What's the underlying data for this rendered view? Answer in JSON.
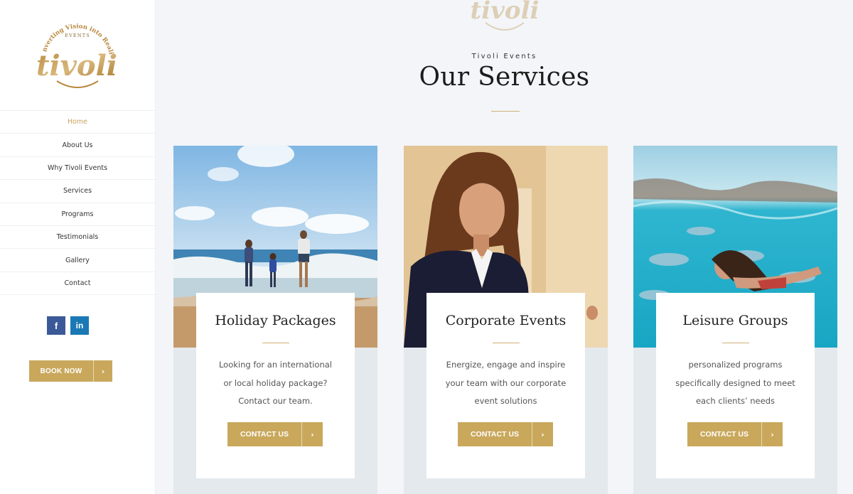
{
  "brand": {
    "logo_text": "tivoli",
    "logo_arc": "Converting Vision into Reality",
    "logo_events": "EVENTS"
  },
  "nav": {
    "items": [
      {
        "label": "Home",
        "active": true
      },
      {
        "label": "About Us"
      },
      {
        "label": "Why Tivoli Events"
      },
      {
        "label": "Services"
      },
      {
        "label": "Programs"
      },
      {
        "label": "Testimonials"
      },
      {
        "label": "Gallery"
      },
      {
        "label": "Contact"
      }
    ]
  },
  "social": {
    "facebook": "f",
    "linkedin": "in"
  },
  "book": {
    "label": "BOOK NOW",
    "arrow": "›"
  },
  "section": {
    "eyebrow": "Tivoli Events",
    "title": "Our Services"
  },
  "cards": [
    {
      "title": "Holiday Packages",
      "body": "Looking for an international or local holiday package? Contact our team.",
      "button": "CONTACT US",
      "arrow": "›",
      "image": "family-beach-photo"
    },
    {
      "title": "Corporate Events",
      "body": "Energize, engage and inspire your team with our corporate event solutions",
      "button": "CONTACT US",
      "arrow": "›",
      "image": "woman-speaker-photo"
    },
    {
      "title": "Leisure Groups",
      "body": "personalized programs specifically designed to meet each clients’ needs",
      "button": "CONTACT US",
      "arrow": "›",
      "image": "underwater-swimmer-photo"
    }
  ],
  "colors": {
    "accent": "#c9a85c",
    "background": "#f3f5f8",
    "card_bg": "#e4e9ed"
  }
}
